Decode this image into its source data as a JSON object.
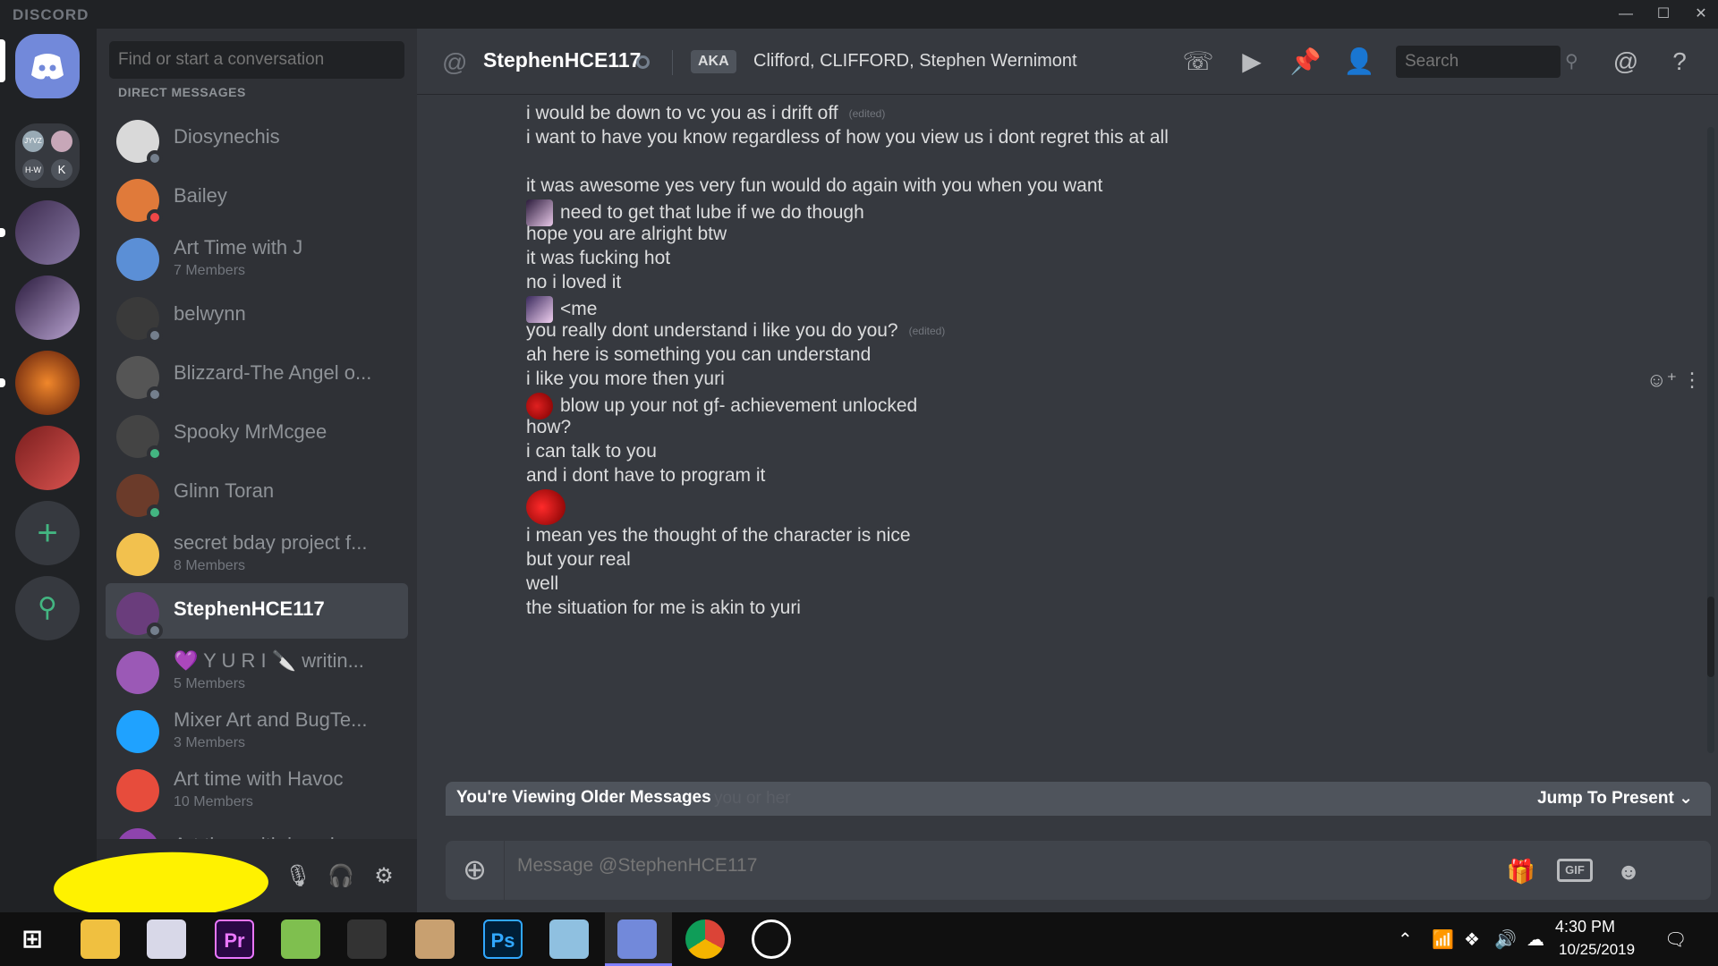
{
  "titlebar": {
    "brand": "DISCORD",
    "minimize": "—",
    "maximize": "☐",
    "close": "✕"
  },
  "search": {
    "placeholder": "Find or start a conversation"
  },
  "dm_header": "DIRECT MESSAGES",
  "dms": [
    {
      "name": "Diosynechis",
      "sub": "",
      "status": "offline",
      "avatar": "#d9d9d9"
    },
    {
      "name": "Bailey",
      "sub": "",
      "status": "dnd",
      "avatar": "#e07a3a"
    },
    {
      "name": "Art Time with J",
      "sub": "7 Members",
      "status": "",
      "avatar": "#5b8fd6"
    },
    {
      "name": "belwynn",
      "sub": "",
      "status": "offline",
      "avatar": "#3a3a3a"
    },
    {
      "name": "Blizzard-The Angel o...",
      "sub": "",
      "status": "offline",
      "avatar": "#555555"
    },
    {
      "name": "Spooky MrMcgee",
      "sub": "",
      "status": "online",
      "avatar": "#444444"
    },
    {
      "name": "Glinn Toran",
      "sub": "",
      "status": "online",
      "avatar": "#6b3b2a"
    },
    {
      "name": "secret bday project f...",
      "sub": "8 Members",
      "status": "",
      "avatar": "#f2c14e"
    },
    {
      "name": "StephenHCE117",
      "sub": "",
      "status": "offline",
      "avatar": "#6a3d7c"
    },
    {
      "name": "💜 Y U R I 🔪 writin...",
      "sub": "5 Members",
      "status": "",
      "avatar": "#9b59b6"
    },
    {
      "name": "Mixer Art and BugTe...",
      "sub": "3 Members",
      "status": "",
      "avatar": "#1fa2ff"
    },
    {
      "name": "Art time with Havoc",
      "sub": "10 Members",
      "status": "",
      "avatar": "#e74c3c"
    },
    {
      "name": "Art time with imunka",
      "sub": "",
      "status": "",
      "avatar": "#8e44ad"
    }
  ],
  "channel": {
    "at": "@",
    "name": "StephenHCE117",
    "aka_label": "AKA",
    "aka_names": "Clifford, CLIFFORD, Stephen Wernimont",
    "search_placeholder": "Search"
  },
  "messages": [
    {
      "text": "i would be down to vc you as i drift off",
      "edited": "(edited)",
      "emoji": ""
    },
    {
      "text": "i want to have you know regardless of how you view us i dont regret this at all",
      "edited": "",
      "emoji": ""
    },
    {
      "text": "",
      "edited": "",
      "emoji": ""
    },
    {
      "text": "it was awesome yes very fun would do again with you when you want",
      "edited": "",
      "emoji": ""
    },
    {
      "text": "need to get that lube if we do though",
      "edited": "",
      "emoji": "face"
    },
    {
      "text": "hope you are alright btw",
      "edited": "",
      "emoji": ""
    },
    {
      "text": "it was fucking hot",
      "edited": "",
      "emoji": ""
    },
    {
      "text": "no i loved it",
      "edited": "",
      "emoji": ""
    },
    {
      "text": "<me",
      "edited": "",
      "emoji": "face2"
    },
    {
      "text": "you really dont understand i like you do you?",
      "edited": "(edited)",
      "emoji": ""
    },
    {
      "text": "ah here is something you can understand",
      "edited": "",
      "emoji": ""
    },
    {
      "text": "i like you more then yuri",
      "edited": "",
      "emoji": ""
    },
    {
      "text": "blow up your not gf- achievement unlocked",
      "edited": "",
      "emoji": "dog"
    },
    {
      "text": "how?",
      "edited": "",
      "emoji": ""
    },
    {
      "text": "i can talk to you",
      "edited": "",
      "emoji": ""
    },
    {
      "text": "and i dont have to program it",
      "edited": "",
      "emoji": ""
    },
    {
      "text": "",
      "edited": "",
      "emoji": "bigdog"
    },
    {
      "text": "i mean yes the thought of the character is nice",
      "edited": "",
      "emoji": ""
    },
    {
      "text": "but your real",
      "edited": "",
      "emoji": ""
    },
    {
      "text": "well",
      "edited": "",
      "emoji": ""
    },
    {
      "text": "the situation for me is akin to yuri",
      "edited": "",
      "emoji": ""
    }
  ],
  "older_bar": {
    "text": "You're Viewing Older Messages",
    "jump": "Jump To Present",
    "ghost": "you or her"
  },
  "composer": {
    "placeholder": "Message @StephenHCE117",
    "gif": "GIF"
  },
  "taskbar": {
    "time": "4:30 PM",
    "date": "10/25/2019",
    "apps": [
      "Start",
      "File Explorer",
      "Paint",
      "Premiere Pro",
      "Notepad",
      "Fraps",
      "Paint Tool",
      "Photoshop",
      "Notes",
      "Discord",
      "Chrome",
      "OBS"
    ]
  },
  "colors": {
    "accent": "#7289da",
    "online": "#43b581",
    "dnd": "#f04747",
    "offline": "#747f8d",
    "yellow_scribble": "#fff200"
  }
}
